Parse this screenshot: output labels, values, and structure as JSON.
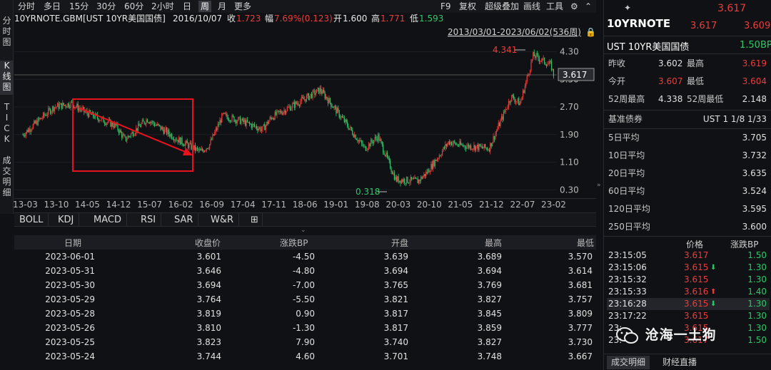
{
  "left_nav": [
    {
      "label": "分时图",
      "active": false
    },
    {
      "label": "K线图",
      "active": true
    },
    {
      "label": "TICK",
      "active": false
    },
    {
      "label": "成交明细",
      "active": false
    }
  ],
  "periods": [
    "分时",
    "多日",
    "15分",
    "30分",
    "60分",
    "2小时",
    "日",
    "周",
    "月",
    "更多"
  ],
  "active_period": "周",
  "toolbar_right": [
    "F9",
    "复权",
    "超级叠加",
    "画线",
    "工具"
  ],
  "info": {
    "symbol": "10YRNOTE.GBM[UST 10YR美国国债]",
    "date": "2016/10/07",
    "close_label": "收",
    "close": "1.723",
    "change_label": "幅",
    "change": "7.69%(0.123)",
    "open_label": "开",
    "open": "1.600",
    "high_label": "高",
    "high": "1.771",
    "low_label": "低",
    "low": "1.593"
  },
  "range_label": "2013/03/01-2023/06/02(536周)",
  "chart_data": {
    "type": "candlestick",
    "y_ticks": [
      "4.30",
      "3.50",
      "2.70",
      "1.90",
      "1.10",
      "0.30"
    ],
    "ylim": [
      0.1,
      4.6
    ],
    "current_price_tag": "3.617",
    "max_marker": "4.341",
    "min_marker": "0.318",
    "x_ticks": [
      "13-03",
      "13-10",
      "14-05",
      "14-12",
      "15-07",
      "16-02",
      "16-09",
      "17-04",
      "17-11",
      "18-06",
      "19-01",
      "19-08",
      "20-03",
      "20-10",
      "21-05",
      "21-12",
      "22-07",
      "23-02"
    ],
    "series": [
      {
        "x": "13-03",
        "y": 1.9
      },
      {
        "x": "13-10",
        "y": 2.7
      },
      {
        "x": "14-02",
        "y": 2.8
      },
      {
        "x": "14-05",
        "y": 2.55
      },
      {
        "x": "14-12",
        "y": 2.15
      },
      {
        "x": "15-02",
        "y": 1.75
      },
      {
        "x": "15-07",
        "y": 2.35
      },
      {
        "x": "16-02",
        "y": 1.75
      },
      {
        "x": "16-07",
        "y": 1.4
      },
      {
        "x": "16-09",
        "y": 1.6
      },
      {
        "x": "16-12",
        "y": 2.45
      },
      {
        "x": "17-04",
        "y": 2.3
      },
      {
        "x": "17-09",
        "y": 2.05
      },
      {
        "x": "17-11",
        "y": 2.4
      },
      {
        "x": "18-06",
        "y": 2.9
      },
      {
        "x": "18-10",
        "y": 3.2
      },
      {
        "x": "19-01",
        "y": 2.7
      },
      {
        "x": "19-08",
        "y": 1.5
      },
      {
        "x": "19-11",
        "y": 1.85
      },
      {
        "x": "20-03",
        "y": 0.6
      },
      {
        "x": "20-08",
        "y": 0.55
      },
      {
        "x": "20-10",
        "y": 0.8
      },
      {
        "x": "21-03",
        "y": 1.7
      },
      {
        "x": "21-05",
        "y": 1.6
      },
      {
        "x": "21-12",
        "y": 1.5
      },
      {
        "x": "22-05",
        "y": 3.0
      },
      {
        "x": "22-07",
        "y": 2.8
      },
      {
        "x": "22-10",
        "y": 4.2
      },
      {
        "x": "23-02",
        "y": 3.9
      },
      {
        "x": "23-03",
        "y": 3.4
      },
      {
        "x": "23-06",
        "y": 3.6
      }
    ]
  },
  "indicator_tabs": [
    "BOLL",
    "KDJ",
    "MACD",
    "RSI",
    "SAR",
    "W&R"
  ],
  "table": {
    "headers": [
      "日期",
      "收盘价",
      "涨跌BP",
      "开盘",
      "最高",
      "最低"
    ],
    "rows": [
      [
        "2023-06-01",
        "3.601",
        "-4.50",
        "3.639",
        "3.689",
        "3.570"
      ],
      [
        "2023-05-31",
        "3.646",
        "-4.80",
        "3.694",
        "3.694",
        "3.614"
      ],
      [
        "2023-05-30",
        "3.694",
        "-7.00",
        "3.765",
        "3.769",
        "3.681"
      ],
      [
        "2023-05-29",
        "3.764",
        "-5.50",
        "3.821",
        "3.827",
        "3.757"
      ],
      [
        "2023-05-28",
        "3.819",
        "0.90",
        "3.817",
        "3.845",
        "3.809"
      ],
      [
        "2023-05-26",
        "3.810",
        "-1.30",
        "3.817",
        "3.859",
        "3.777"
      ],
      [
        "2023-05-25",
        "3.823",
        "7.90",
        "3.740",
        "3.827",
        "3.730"
      ],
      [
        "2023-05-24",
        "3.744",
        "4.60",
        "3.701",
        "3.748",
        "3.667"
      ]
    ]
  },
  "right": {
    "top_price": "3.617",
    "name": "10YRNOTE",
    "bid": "3.617",
    "ask": "3.609",
    "full_name": "UST 10YR美国国债",
    "change_bp": "1.50BP",
    "quote": [
      {
        "l1": "昨收",
        "v1": "3.602",
        "c1": "white",
        "l2": "最高",
        "v2": "3.619",
        "c2": "red"
      },
      {
        "l1": "今开",
        "v1": "3.607",
        "c1": "red",
        "l2": "最低",
        "v2": "3.604",
        "c2": "red"
      },
      {
        "l1": "52周最高",
        "v1": "4.338",
        "c1": "white",
        "l2": "52周最低",
        "v2": "2.148",
        "c2": "white"
      }
    ],
    "bench_label": "基准债券",
    "bench_value": "UST 1 1/8 1/33",
    "averages": [
      {
        "label": "5日平均",
        "value": "3.705"
      },
      {
        "label": "10日平均",
        "value": "3.732"
      },
      {
        "label": "20日平均",
        "value": "3.635"
      },
      {
        "label": "60日平均",
        "value": "3.524"
      },
      {
        "label": "120日平均",
        "value": "3.595"
      },
      {
        "label": "250日平均",
        "value": "3.600"
      }
    ],
    "tick_headers": [
      "价格",
      "涨跌BP"
    ],
    "ticks": [
      {
        "time": "23:15:05",
        "price": "3.617",
        "arrow": "",
        "bp": "1.50"
      },
      {
        "time": "23:15:06",
        "price": "3.615",
        "arrow": "down",
        "bp": "1.30"
      },
      {
        "time": "23:15:32",
        "price": "3.615",
        "arrow": "",
        "bp": "1.30"
      },
      {
        "time": "23:15:33",
        "price": "3.616",
        "arrow": "up",
        "bp": "1.40"
      },
      {
        "time": "23:16:28",
        "price": "3.615",
        "arrow": "down",
        "bp": "1.30"
      },
      {
        "time": "23:17:22",
        "price": "3.615",
        "arrow": "",
        "bp": "1.30"
      },
      {
        "time": "23:",
        "price": "3.615",
        "arrow": "",
        "bp": "1.30"
      },
      {
        "time": "23:",
        "price": "3.617",
        "arrow": "",
        "bp": "1.50"
      }
    ],
    "bottom_tabs": [
      "成交明细",
      "财经直播"
    ]
  },
  "watermark": "沧海一土狗",
  "colors": {
    "up": "#ee3b3b",
    "down": "#2fc76a",
    "box": "#e8121f",
    "bg": "#101114"
  }
}
